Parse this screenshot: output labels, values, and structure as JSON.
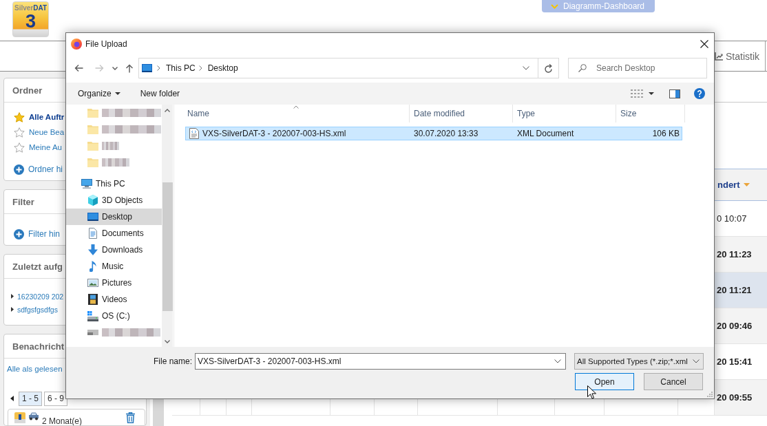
{
  "page": {
    "logo": {
      "name_part_1": "Silver",
      "name_part_2": "DAT",
      "number": "3"
    },
    "dashboard_tab": {
      "label": "Diagramm-Dashboard"
    },
    "statistik_tab": {
      "label": "Statistik"
    },
    "sidebar": {
      "ordner": {
        "title": "Ordner",
        "items": [
          {
            "label": "Alle Auftr",
            "starred": true,
            "selected": true
          },
          {
            "label": "Neue Bea",
            "starred": false,
            "selected": false
          },
          {
            "label": "Meine Au",
            "starred": false,
            "selected": false
          }
        ],
        "add_link": "Ordner hi"
      },
      "filter": {
        "title": "Filter",
        "add_link": "Filter hin"
      },
      "recent": {
        "title": "Zuletzt aufg",
        "items": [
          {
            "label": "16230209 202"
          },
          {
            "label": "sdfgsfgsdfgs"
          }
        ]
      },
      "notifications": {
        "title": "Benachricht",
        "mark_all_read": "Alle als gelesen",
        "pages": [
          {
            "label": "1 - 5",
            "selected": true
          },
          {
            "label": "6 - 9",
            "selected": false
          }
        ],
        "items": [
          {
            "text": "2 Monat(e)"
          }
        ]
      }
    },
    "table": {
      "column_header": "ndert",
      "sorted": true,
      "rows": [
        {
          "cell": "0 10:07",
          "unread": false,
          "selected": false
        },
        {
          "cell": "20 11:23",
          "unread": true,
          "selected": false
        },
        {
          "cell": "20 11:21",
          "unread": true,
          "selected": true
        },
        {
          "cell": "20 09:46",
          "unread": true,
          "selected": false
        },
        {
          "cell": "20 15:41",
          "unread": true,
          "selected": false
        },
        {
          "cell": "20 09:55",
          "unread": true,
          "selected": false
        }
      ]
    }
  },
  "dialog": {
    "title": "File Upload",
    "nav_buttons": [
      {
        "kind": "back",
        "disabled": false
      },
      {
        "kind": "forward",
        "disabled": true
      },
      {
        "kind": "recent",
        "disabled": false
      },
      {
        "kind": "up",
        "disabled": false
      }
    ],
    "address": {
      "path": [
        "This PC",
        "Desktop"
      ]
    },
    "search": {
      "placeholder": "Search Desktop"
    },
    "toolbar": {
      "organize": "Organize",
      "new_folder": "New folder"
    },
    "nav_pane": {
      "tree": [
        {
          "children": [
            {
              "kind": "folder",
              "selected": false
            },
            {
              "kind": "folder",
              "selected": false
            },
            {
              "kind": "folder",
              "selected": false
            },
            {
              "kind": "folder",
              "selected": false
            }
          ]
        },
        {
          "kind": "pc",
          "label": "This PC",
          "selected": false,
          "children": [
            {
              "kind": "objects",
              "label": "3D Objects",
              "selected": false
            },
            {
              "kind": "desktop",
              "label": "Desktop",
              "selected": true
            },
            {
              "kind": "documents",
              "label": "Documents",
              "selected": false
            },
            {
              "kind": "downloads",
              "label": "Downloads",
              "selected": false
            },
            {
              "kind": "music",
              "label": "Music",
              "selected": false
            },
            {
              "kind": "pictures",
              "label": "Pictures",
              "selected": false
            },
            {
              "kind": "videos",
              "label": "Videos",
              "selected": false
            },
            {
              "kind": "system",
              "label": "OS (C:)",
              "selected": false
            },
            {
              "kind": "drive",
              "selected": false
            }
          ]
        }
      ]
    },
    "file_list": {
      "columns": [
        {
          "label": "Name",
          "sorted": true
        },
        {
          "label": "Date modified",
          "sorted": false
        },
        {
          "label": "Type",
          "sorted": false
        },
        {
          "label": "Size",
          "sorted": false
        }
      ],
      "rows": [
        {
          "name": "VXS-SilverDAT-3 - 202007-003-HS.xml",
          "date_modified": "30.07.2020 13:33",
          "type": "XML Document",
          "size": "106 KB",
          "selected": true
        }
      ]
    },
    "file_name": {
      "label": "File name:",
      "value": "VXS-SilverDAT-3 - 202007-003-HS.xml"
    },
    "file_type": {
      "value": "All Supported Types (*.zip;*.xml"
    },
    "buttons": [
      {
        "label": "Open",
        "default": true
      },
      {
        "label": "Cancel",
        "default": false
      }
    ]
  }
}
